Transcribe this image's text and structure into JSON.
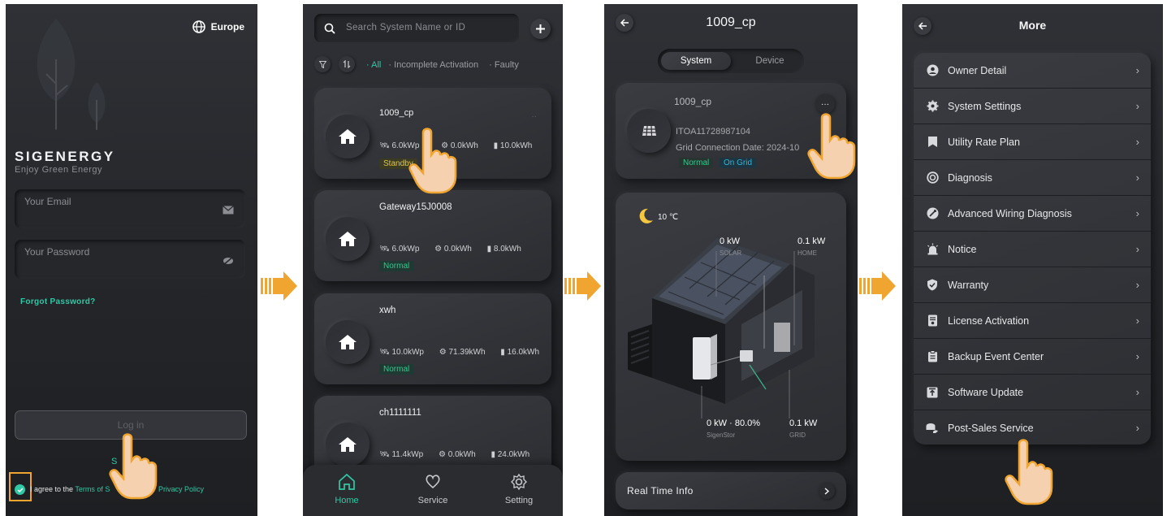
{
  "login": {
    "region": "Europe",
    "brand": "SIGENERGY",
    "tagline": "Enjoy Green Energy",
    "email_placeholder": "Your Email",
    "password_placeholder": "Your Password",
    "forgot_password": "Forgot Password?",
    "login_button": "Log in",
    "signup_partial": "S",
    "agree_prefix": "I agree to the",
    "terms_partial": "Terms of S",
    "privacy_policy": "Privacy Policy"
  },
  "home": {
    "search_placeholder": "Search System Name or ID",
    "filters": [
      "All",
      "Incomplete Activation",
      "Faulty"
    ],
    "systems": [
      {
        "name": "1009_cp",
        "solar": "6.0kWp",
        "energy": "0.0kWh",
        "battery": "10.0kWh",
        "status": "Standby",
        "status_color": "#e1c64a"
      },
      {
        "name": "Gateway15J0008",
        "solar": "6.0kWp",
        "energy": "0.0kWh",
        "battery": "8.0kWh",
        "status": "Normal",
        "status_color": "#32c88f"
      },
      {
        "name": "xwh",
        "solar": "10.0kWp",
        "energy": "71.39kWh",
        "battery": "16.0kWh",
        "status": "Normal",
        "status_color": "#32c88f"
      },
      {
        "name": "ch1111111",
        "solar": "11.4kWp",
        "energy": "0.0kWh",
        "battery": "24.0kWh",
        "status": "",
        "status_color": "#32c88f"
      }
    ],
    "nav": {
      "home": "Home",
      "service": "Service",
      "setting": "Setting"
    }
  },
  "system": {
    "title": "1009_cp",
    "tab_system": "System",
    "tab_device": "Device",
    "name": "1009_cp",
    "id": "ITOA11728987104",
    "grid_connection": "Grid Connection Date: 2024-10",
    "status": "Normal",
    "grid_status": "On Grid",
    "temperature": "10 ℃",
    "solar_value": "0 kW",
    "solar_label": "SOLAR",
    "home_value": "0.1 kW",
    "home_label": "HOME",
    "storage_value": "0 kW · 80.0%",
    "storage_label": "SigenStor",
    "grid_value": "0.1 kW",
    "grid_label": "GRID",
    "realtime": "Real Time Info"
  },
  "more": {
    "title": "More",
    "items": [
      {
        "label": "Owner Detail",
        "icon": "user-icon"
      },
      {
        "label": "System Settings",
        "icon": "gear-icon"
      },
      {
        "label": "Utility Rate Plan",
        "icon": "bookmark-icon"
      },
      {
        "label": "Diagnosis",
        "icon": "diagnosis-icon"
      },
      {
        "label": "Advanced Wiring Diagnosis",
        "icon": "wiring-icon"
      },
      {
        "label": "Notice",
        "icon": "alarm-icon"
      },
      {
        "label": "Warranty",
        "icon": "shield-icon"
      },
      {
        "label": "License Activation",
        "icon": "license-icon"
      },
      {
        "label": "Backup Event Center",
        "icon": "clipboard-icon"
      },
      {
        "label": "Software Update",
        "icon": "upload-icon"
      },
      {
        "label": "Post-Sales Service",
        "icon": "service-icon"
      }
    ]
  },
  "colors": {
    "accent": "#31c8a5",
    "arrow": "#f0a530",
    "highlight_box": "#f0a530"
  }
}
